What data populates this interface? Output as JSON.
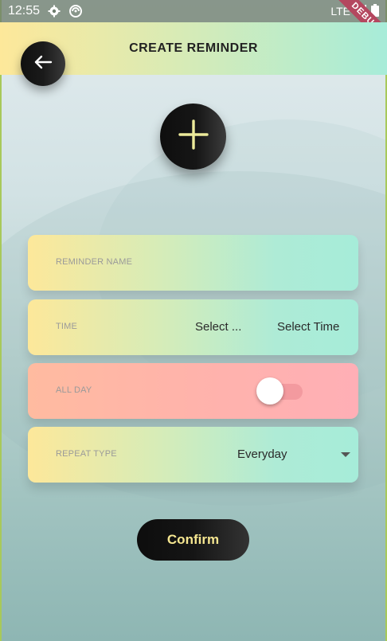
{
  "status_bar": {
    "time": "12:55",
    "icons": [
      "gear-icon",
      "sync-icon"
    ],
    "network_label": "LTE",
    "debug_banner": "DEBUG"
  },
  "app_bar": {
    "title": "CREATE REMINDER",
    "back_icon": "arrow-left-icon"
  },
  "add_button": {
    "icon": "plus-icon"
  },
  "form": {
    "reminder_name": {
      "label": "REMINDER NAME"
    },
    "time": {
      "label": "TIME",
      "date_value": "Select ...",
      "time_value": "Select Time"
    },
    "all_day": {
      "label": "ALL DAY",
      "enabled": false
    },
    "repeat_type": {
      "label": "REPEAT TYPE",
      "value": "Everyday"
    }
  },
  "confirm_label": "Confirm",
  "colors": {
    "gradient_start": "#fde89a",
    "gradient_end": "#a6ecd9",
    "pink_card": "#ffb3ab",
    "button_dark": "#111111",
    "confirm_text": "#f5e690"
  }
}
